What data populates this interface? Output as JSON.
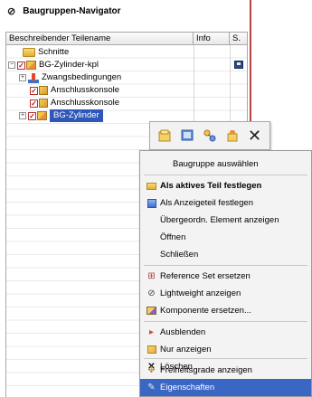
{
  "navigator": {
    "title": "Baugruppen-Navigator",
    "columns": {
      "name": "Beschreibender Teilename",
      "info": "Info",
      "s": "S."
    }
  },
  "tree": {
    "schnitte": "Schnitte",
    "root": "BG-Zylinder-kpl",
    "constraints": "Zwangsbedingungen",
    "part1": "Anschlusskonsole",
    "part2": "Anschlusskonsole",
    "selected": "BG-Zylinder"
  },
  "toolbar": {
    "icons": [
      "assembly-select-icon",
      "display-part-icon",
      "parent-icon",
      "open-icon",
      "close-icon"
    ],
    "close_glyph": "✕"
  },
  "menu": {
    "items": [
      {
        "label": "Baugruppe auswählen",
        "icon": "none"
      },
      {
        "label": "Als aktives Teil festlegen",
        "icon": "work-part-icon"
      },
      {
        "label": "Als Anzeigeteil festlegen",
        "icon": "display-part-icon"
      },
      {
        "label": "Übergeordn. Element anzeigen",
        "icon": "none"
      },
      {
        "label": "Öffnen",
        "icon": "none"
      },
      {
        "label": "Schließen",
        "icon": "none"
      },
      {
        "label": "Reference Set ersetzen",
        "icon": "reference-set-icon"
      },
      {
        "label": "Lightweight anzeigen",
        "icon": "lightweight-icon"
      },
      {
        "label": "Komponente ersetzen...",
        "icon": "replace-component-icon"
      },
      {
        "label": "Ausblenden",
        "icon": "hide-icon"
      },
      {
        "label": "Nur anzeigen",
        "icon": "show-only-icon"
      },
      {
        "label": "Löschen",
        "icon": "delete-icon"
      },
      {
        "label": "Freiheitsgrade anzeigen",
        "icon": "degrees-of-freedom-icon"
      },
      {
        "label": "Eigenschaften",
        "icon": "properties-icon"
      }
    ],
    "highlighted": "Eigenschaften"
  },
  "colors": {
    "selection": "#2e57b8",
    "highlight": "#3a66c4",
    "divider": "#b2433f"
  }
}
